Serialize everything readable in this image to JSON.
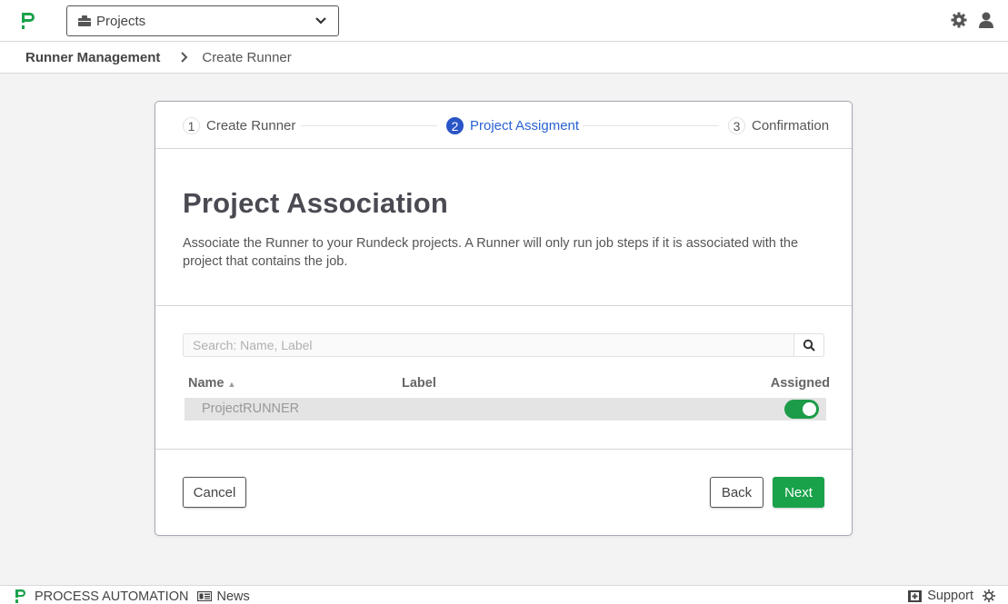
{
  "topbar": {
    "logo": "process-automation-logo",
    "project_selector": "Projects",
    "icons": [
      "gear-icon",
      "user-icon"
    ]
  },
  "breadcrumb": {
    "root": "Runner Management",
    "current": "Create Runner"
  },
  "stepper": {
    "steps": [
      {
        "number": "1",
        "label": "Create Runner",
        "active": false
      },
      {
        "number": "2",
        "label": "Project Assigment",
        "active": true
      },
      {
        "number": "3",
        "label": "Confirmation",
        "active": false
      }
    ]
  },
  "section": {
    "title": "Project Association",
    "description": "Associate the Runner to your Rundeck projects. A Runner will only run job steps if it is associated with the project that contains the job."
  },
  "search": {
    "placeholder": "Search: Name, Label",
    "value": ""
  },
  "table": {
    "columns": {
      "name": "Name",
      "name_sort": "▲",
      "label": "Label",
      "assigned": "Assigned"
    },
    "rows": [
      {
        "name": "ProjectRUNNER",
        "label": "",
        "assigned": true
      }
    ]
  },
  "buttons": {
    "cancel": "Cancel",
    "back": "Back",
    "next": "Next"
  },
  "footer": {
    "brand": "PROCESS AUTOMATION",
    "news": "News",
    "support": "Support"
  },
  "colors": {
    "brand_green": "#1aa24b",
    "active_step": "#2a55c6",
    "toggle_on": "#1c9c48"
  }
}
